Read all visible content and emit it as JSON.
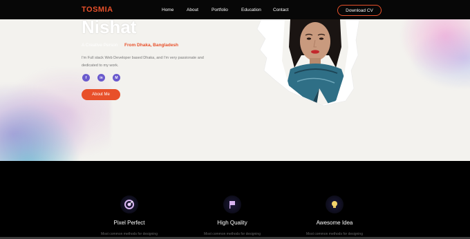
{
  "navbar": {
    "brand": "TOSMIA",
    "links": [
      "Home",
      "About",
      "Portfolio",
      "Education",
      "Contact"
    ],
    "download_label": "Download CV"
  },
  "hero": {
    "name": "Nishat",
    "tagline": "A Creative Person",
    "location": "From Dhaka, Bangladesh",
    "bio": "I'm Full stack Web Developer based Dhaka, and I'm very passionate and dedicated to my work.",
    "social": [
      {
        "icon": "facebook-icon",
        "glyph": "f"
      },
      {
        "icon": "linkedin-icon",
        "glyph": "in"
      },
      {
        "icon": "github-icon",
        "glyph": "M"
      }
    ],
    "about_label": "About Me"
  },
  "features": [
    {
      "title": "Pixel Perfect",
      "desc": "Most common methods for designing",
      "icon": "target-icon"
    },
    {
      "title": "High Quality",
      "desc": "Most common methods for designing",
      "icon": "flag-icon"
    },
    {
      "title": "Awesome Idea",
      "desc": "Most common methods for designing",
      "icon": "lightbulb-icon"
    }
  ],
  "colors": {
    "accent": "#e8502a",
    "social": "#6a5acd",
    "dark_bg": "#000000",
    "hero_bg": "#f3f2ee"
  }
}
